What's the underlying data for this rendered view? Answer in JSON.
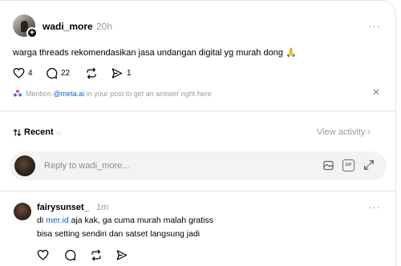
{
  "post": {
    "username": "wadi_more",
    "time": "20h",
    "text": "warga threads rekomendasikan jasa undangan digital yg murah dong 🙏",
    "likes": "4",
    "comments": "22",
    "reposts": "",
    "shares": "1",
    "mention_prefix": "Mention ",
    "mention_link": "@meta.ai",
    "mention_suffix": " in your post to get an answer right here",
    "more": "···",
    "close": "✕"
  },
  "sort": {
    "label": "Recent",
    "view_activity": "View activity"
  },
  "reply": {
    "placeholder": "Reply to wadi_more..."
  },
  "comment": {
    "username": "fairysunset_",
    "time": "1m",
    "line1_prefix": "di ",
    "line1_link": "mer.id",
    "line1_suffix": " aja kak, ga cuma murah malah gratiss",
    "line2": "bisa setting sendiri dan satset langsung jadi",
    "more": "···"
  }
}
